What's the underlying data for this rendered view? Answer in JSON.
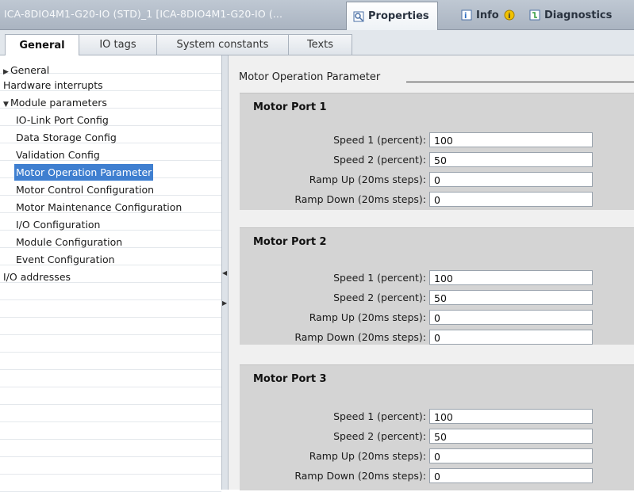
{
  "window": {
    "title": "ICA-8DIO4M1-G20-IO  (STD)_1  [ICA-8DIO4M1-G20-IO  (...",
    "tabs": [
      {
        "label": "Properties",
        "icon": "properties-icon",
        "active": true
      },
      {
        "label": "Info",
        "icon": "info-icon",
        "badge_icon": "warning-badge-icon",
        "active": false
      },
      {
        "label": "Diagnostics",
        "icon": "diagnostics-icon",
        "active": false
      }
    ]
  },
  "subtabs": [
    {
      "label": "General",
      "active": true
    },
    {
      "label": "IO tags",
      "active": false
    },
    {
      "label": "System constants",
      "active": false
    },
    {
      "label": "Texts",
      "active": false
    }
  ],
  "nav": {
    "items": [
      {
        "label": "General",
        "arrow": "▶"
      },
      {
        "label": "Hardware interrupts",
        "arrow": ""
      },
      {
        "label": "Module parameters",
        "arrow": "▼"
      },
      {
        "label": "IO-Link Port Config"
      },
      {
        "label": "Data Storage Config"
      },
      {
        "label": "Validation Config"
      },
      {
        "label": "Motor Operation Parameter",
        "selected": true
      },
      {
        "label": "Motor Control Configuration"
      },
      {
        "label": "Motor Maintenance Configuration"
      },
      {
        "label": "I/O Configuration"
      },
      {
        "label": "Module Configuration"
      },
      {
        "label": "Event Configuration"
      },
      {
        "label": "I/O addresses",
        "arrow": ""
      }
    ]
  },
  "content": {
    "section_title": "Motor Operation Parameter",
    "groups": [
      {
        "title": "Motor Port 1",
        "fields": [
          {
            "label": "Speed 1 (percent):",
            "value": "100"
          },
          {
            "label": "Speed 2 (percent):",
            "value": "50"
          },
          {
            "label": "Ramp Up (20ms steps):",
            "value": "0"
          },
          {
            "label": "Ramp Down (20ms steps):",
            "value": "0"
          }
        ]
      },
      {
        "title": "Motor Port 2",
        "fields": [
          {
            "label": "Speed 1 (percent):",
            "value": "100"
          },
          {
            "label": "Speed 2 (percent):",
            "value": "50"
          },
          {
            "label": "Ramp Up (20ms steps):",
            "value": "0"
          },
          {
            "label": "Ramp Down (20ms steps):",
            "value": "0"
          }
        ]
      },
      {
        "title": "Motor Port 3",
        "fields": [
          {
            "label": "Speed 1 (percent):",
            "value": "100"
          },
          {
            "label": "Speed 2 (percent):",
            "value": "50"
          },
          {
            "label": "Ramp Up (20ms steps):",
            "value": "0"
          },
          {
            "label": "Ramp Down (20ms steps):",
            "value": "0"
          }
        ]
      }
    ]
  },
  "colors": {
    "selection": "#3f7fd0",
    "group_bg": "#d4d4d4",
    "titlebar": "#aab4c1"
  }
}
